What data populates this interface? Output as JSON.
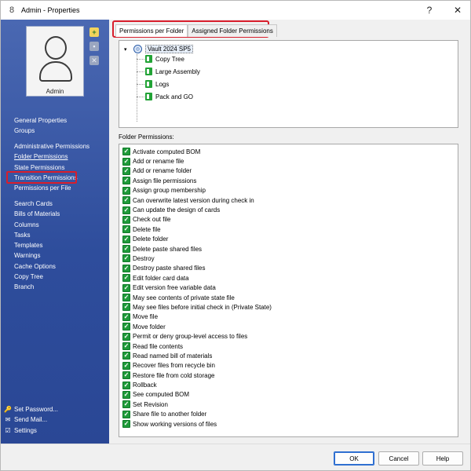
{
  "window": {
    "title": "Admin - Properties",
    "help_label": "?",
    "close_label": "✕"
  },
  "sidebar": {
    "user_name": "Admin",
    "nav_group1": [
      "General Properties",
      "Groups"
    ],
    "nav_group2": [
      "Administrative Permissions",
      "Folder Permissions",
      "State Permissions",
      "Transition Permissions",
      "Permissions per File"
    ],
    "nav_group3": [
      "Search Cards",
      "Bills of Materials",
      "Columns",
      "Tasks",
      "Templates",
      "Warnings",
      "Cache Options",
      "Copy Tree",
      "Branch"
    ],
    "actions": [
      "Set Password...",
      "Send Mail...",
      "Settings"
    ]
  },
  "tabs": [
    "Permissions per Folder",
    "Assigned Folder Permissions"
  ],
  "tree": {
    "root": "Vault 2024 SP5",
    "children": [
      "Copy Tree",
      "Large Assembly",
      "Logs",
      "Pack and GO"
    ]
  },
  "permissions": {
    "label": "Folder Permissions:",
    "items": [
      "Activate computed BOM",
      "Add or rename file",
      "Add or rename folder",
      "Assign file permissions",
      "Assign group membership",
      "Can overwrite latest version during check in",
      "Can update the design of cards",
      "Check out file",
      "Delete file",
      "Delete folder",
      "Delete paste shared files",
      "Destroy",
      "Destroy paste shared files",
      "Edit folder card data",
      "Edit version free variable data",
      "May see contents of private state file",
      "May see files before initial check in (Private State)",
      "Move file",
      "Move folder",
      "Permit or deny group-level access to files",
      "Read file contents",
      "Read named bill of materials",
      "Recover files from recycle bin",
      "Restore file from cold storage",
      "Rollback",
      "See computed BOM",
      "Set Revision",
      "Share file to another folder",
      "Show working versions of files"
    ]
  },
  "footer": {
    "ok": "OK",
    "cancel": "Cancel",
    "help": "Help"
  },
  "colors": {
    "sidebar": "#2e4d9c",
    "highlight": "#d81e2c",
    "checkbox": "#1f9a3a"
  }
}
